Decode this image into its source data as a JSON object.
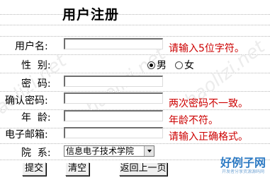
{
  "title": "用户注册",
  "watermark": "haolizi.net",
  "fields": {
    "username": {
      "label": "用户名:",
      "value": "",
      "error": "请输入5位字符。"
    },
    "gender": {
      "label": "性  别:",
      "options": [
        "男",
        "女"
      ],
      "selected": "男"
    },
    "password": {
      "label": "密  码:",
      "value": "",
      "error": ""
    },
    "confirm": {
      "label": "确认密码:",
      "value": "",
      "error": "两次密码不一致。"
    },
    "age": {
      "label": "年  龄:",
      "value": "",
      "error": "年龄不符。"
    },
    "email": {
      "label": "电子邮箱:",
      "value": "",
      "error": "请输入正确格式。"
    },
    "department": {
      "label": "院  系:",
      "selected": "信息电子技术学院"
    }
  },
  "buttons": {
    "submit": "提交",
    "clear": "清空",
    "back": "返回上一页"
  },
  "logo": {
    "text": "好例子网",
    "tagline": "开发者分享资源源码网"
  },
  "colors": {
    "error": "#cc0000",
    "logo": "#2e7bc4"
  }
}
